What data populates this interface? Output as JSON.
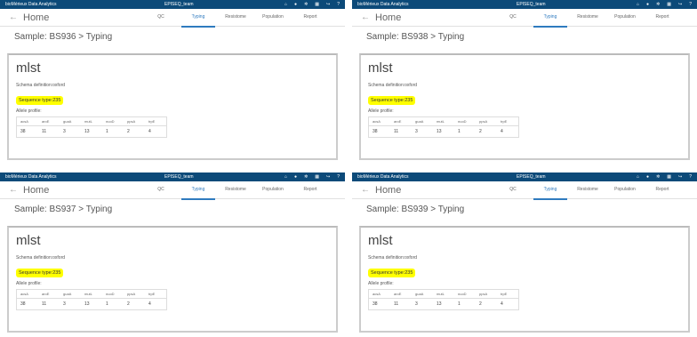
{
  "app": {
    "brand": "bioMérieux Data Analytics",
    "team": "EPISEQ_team",
    "header_icons": [
      "home-icon",
      "user-icon",
      "settings-icon",
      "grid-icon",
      "logout-icon",
      "help-icon"
    ],
    "home_label": "Home",
    "back_glyph": "←",
    "tabs": [
      "QC",
      "Typing",
      "Resistome",
      "Population",
      "Report"
    ],
    "active_tab": "Typing"
  },
  "panels": [
    {
      "sample_crumb": "Sample: BS936 > Typing",
      "scheme_title": "mlst",
      "schema_definition": "Schema definition:oxford",
      "sequence_type": "Sequence type:235",
      "allele_profile_label": "Allele profile:",
      "allele_headers": [
        "acsA",
        "aroE",
        "guaA",
        "mutL",
        "nuoD",
        "ppsA",
        "trpE"
      ],
      "allele_values": [
        "38",
        "11",
        "3",
        "13",
        "1",
        "2",
        "4"
      ]
    },
    {
      "sample_crumb": "Sample: BS938 > Typing",
      "scheme_title": "mlst",
      "schema_definition": "Schema definition:oxford",
      "sequence_type": "Sequence type:235",
      "allele_profile_label": "Allele profile:",
      "allele_headers": [
        "acsA",
        "aroE",
        "guaA",
        "mutL",
        "nuoD",
        "ppsA",
        "trpE"
      ],
      "allele_values": [
        "38",
        "11",
        "3",
        "13",
        "1",
        "2",
        "4"
      ]
    },
    {
      "sample_crumb": "Sample: BS937 > Typing",
      "scheme_title": "mlst",
      "schema_definition": "Schema definition:oxford",
      "sequence_type": "Sequence type:235",
      "allele_profile_label": "Allele profile:",
      "allele_headers": [
        "acsA",
        "aroE",
        "guaA",
        "mutL",
        "nuoD",
        "ppsA",
        "trpE"
      ],
      "allele_values": [
        "38",
        "11",
        "3",
        "13",
        "1",
        "2",
        "4"
      ]
    },
    {
      "sample_crumb": "Sample: BS939 > Typing",
      "scheme_title": "mlst",
      "schema_definition": "Schema definition:oxford",
      "sequence_type": "Sequence type:235",
      "allele_profile_label": "Allele profile:",
      "allele_headers": [
        "acsA",
        "aroE",
        "guaA",
        "mutL",
        "nuoD",
        "ppsA",
        "trpE"
      ],
      "allele_values": [
        "38",
        "11",
        "3",
        "13",
        "1",
        "2",
        "4"
      ]
    }
  ],
  "colors": {
    "topbar": "#0c4a79",
    "active_tab": "#2f7bbf",
    "highlight": "#ffff00"
  }
}
